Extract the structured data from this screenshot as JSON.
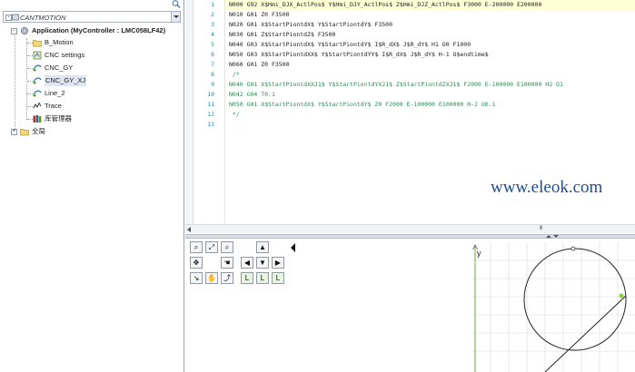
{
  "project_tree": {
    "root_label": "CANTMOTION",
    "items": [
      {
        "label": "Application (MyController : LMC058LF42)",
        "icon": "application-icon"
      },
      {
        "label": "B_Motion",
        "icon": "folder-icon"
      },
      {
        "label": "CNC settings",
        "icon": "cnc-settings-icon"
      },
      {
        "label": "CNC_GY",
        "icon": "cnc-program-icon"
      },
      {
        "label": "CNC_GY_XJ",
        "icon": "cnc-program-icon"
      },
      {
        "label": "Line_2",
        "icon": "cnc-program-icon"
      },
      {
        "label": "Trace",
        "icon": "trace-icon"
      },
      {
        "label": "库管理器",
        "icon": "library-manager-icon"
      },
      {
        "label": "全局",
        "icon": "folder-icon"
      }
    ]
  },
  "editor": {
    "line_numbers": [
      "1",
      "2",
      "3",
      "4",
      "5",
      "6",
      "7",
      "8",
      "9",
      "10",
      "11",
      "12",
      "13"
    ],
    "code_lines": [
      "N000 G92 X$Hmi_DJX_ActlPos$ Y$Hmi_DJY_ActlPos$ Z$Hmi_DJZ_ActlPos$ F3000 E-200000 E200000",
      "N010 G01 Z0 F3500",
      "N020 G01 X$StartPiontdX$ Y$StartPiontdY$ F3500",
      "N030 G01 Z$StartPiontdZ$ F3500",
      "N040 G03 X$StartPiontdX$ Y$StartPiontdY$ I$R_dX$ J$R_dY$ H1 O0 F1000",
      "N050 G03 X$StartPiontdXX$ Y$StartPiontdYY$ I$R_dX$ J$R_dY$ H-1 O$endtime$",
      "N060 G01 Z0 F3500",
      " /*",
      "N040 G01 X$StartPiontdXXJ1$ Y$StartPiontdYXJ1$ Z$StartPiontdZXJ1$ F2000 E-100000 E100000 H2 O1",
      "N042 G04 T0.1",
      "N050 G01 X$StartPiontdX$ Y$StartPiontdY$ Z0 F2000 E-100000 E100000 H-2 O0.1",
      " */",
      ""
    ],
    "watermark": "www.eleok.com",
    "scroll_grip": "III"
  },
  "viewer": {
    "toolbar": [
      {
        "name": "zoom-in-icon",
        "glyph": "⌕"
      },
      {
        "name": "zoom-fit-icon",
        "glyph": "⤢"
      },
      {
        "name": "zoom-out-icon",
        "glyph": "⌕"
      },
      {
        "name": "cursor-icon",
        "glyph": "▲"
      },
      {
        "name": "pan-icon",
        "glyph": "✥"
      },
      {
        "name": "hand-icon",
        "glyph": "☚"
      },
      {
        "name": "step-back-icon",
        "glyph": "◀"
      },
      {
        "name": "step-down-icon",
        "glyph": "▼"
      },
      {
        "name": "step-forward-icon",
        "glyph": "▶"
      },
      {
        "name": "path-icon",
        "glyph": "↘"
      },
      {
        "name": "hand-select-icon",
        "glyph": "✋"
      },
      {
        "name": "curve-icon",
        "glyph": "⤴"
      },
      {
        "name": "view-l1-icon",
        "glyph": "L"
      },
      {
        "name": "view-l2-icon",
        "glyph": "L"
      },
      {
        "name": "view-l3-icon",
        "glyph": "L"
      }
    ],
    "axis_label_y": "y"
  }
}
